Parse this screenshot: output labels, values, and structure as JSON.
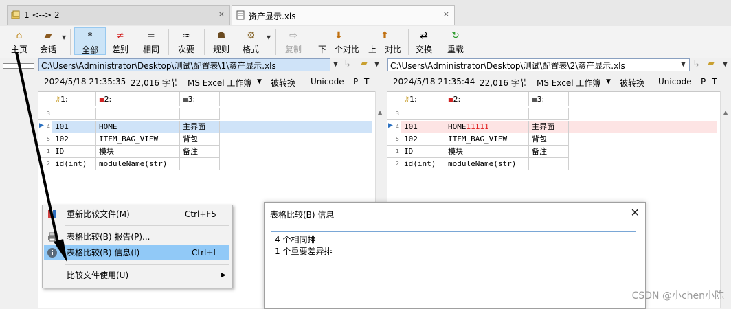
{
  "tabs": [
    {
      "label": "1 <--> 2",
      "close": "×"
    },
    {
      "label": "资产显示.xls",
      "close": "×"
    }
  ],
  "toolbar": {
    "home": "主页",
    "session": "会话",
    "all": "全部",
    "diff": "差别",
    "same": "相同",
    "minor": "次要",
    "rules": "规则",
    "format": "格式",
    "copy": "复制",
    "next": "下一个对比",
    "prev": "上一对比",
    "swap": "交换",
    "reload": "重载"
  },
  "left": {
    "path": "C:\\Users\\Administrator\\Desktop\\测试\\配置表\\1\\资产显示.xls",
    "date": "2024/5/18 21:35:35",
    "size": "22,016 字节",
    "format": "MS Excel 工作簿",
    "converted": "被转换",
    "encoding": "Unicode",
    "p": "P",
    "t": "T",
    "headers": [
      "1:",
      "2:",
      "3:"
    ],
    "rows": [
      {
        "num": "3",
        "c1": "",
        "c2": "",
        "c3": ""
      },
      {
        "num": "4",
        "c1": "101",
        "c2": "HOME",
        "c3": "主界面"
      },
      {
        "num": "5",
        "c1": "102",
        "c2": "ITEM_BAG_VIEW",
        "c3": "背包"
      },
      {
        "num": "1",
        "c1": "ID",
        "c2": "模块",
        "c3": "备注"
      },
      {
        "num": "2",
        "c1": "id(int)",
        "c2": "moduleName(str)",
        "c3": ""
      }
    ]
  },
  "right": {
    "path": "C:\\Users\\Administrator\\Desktop\\测试\\配置表\\2\\资产显示.xls",
    "date": "2024/5/18 21:35:44",
    "size": "22,016 字节",
    "format": "MS Excel 工作簿",
    "converted": "被转换",
    "encoding": "Unicode",
    "p": "P",
    "t": "T",
    "headers": [
      "1:",
      "2:",
      "3:"
    ],
    "rows": [
      {
        "num": "3",
        "c1": "",
        "c2": "",
        "c3": ""
      },
      {
        "num": "4",
        "c1": "101",
        "c2a": "HOME",
        "c2b": "11111",
        "c3": "主界面"
      },
      {
        "num": "5",
        "c1": "102",
        "c2": "ITEM_BAG_VIEW",
        "c3": "背包"
      },
      {
        "num": "1",
        "c1": "ID",
        "c2": "模块",
        "c3": "备注"
      },
      {
        "num": "2",
        "c1": "id(int)",
        "c2": "moduleName(str)",
        "c3": ""
      }
    ]
  },
  "menu": {
    "items": [
      {
        "label": "重新比较文件(M)",
        "key": "Ctrl+F5"
      },
      {
        "label": "表格比较(B) 报告(P)...",
        "key": ""
      },
      {
        "label": "表格比较(B) 信息(I)",
        "key": "Ctrl+I"
      },
      {
        "label": "比较文件使用(U)",
        "key": ""
      }
    ]
  },
  "dialog": {
    "title": "表格比较(B) 信息",
    "close": "✕",
    "lines": [
      "4 个相同排",
      "1 个重要差异排"
    ]
  },
  "watermark": "CSDN @小chen小陈",
  "colors": {
    "selected_row": "#cfe3f8",
    "diff_row": "#fde4e4",
    "diff_text": "#e02020",
    "highlight": "#91c9f7"
  }
}
